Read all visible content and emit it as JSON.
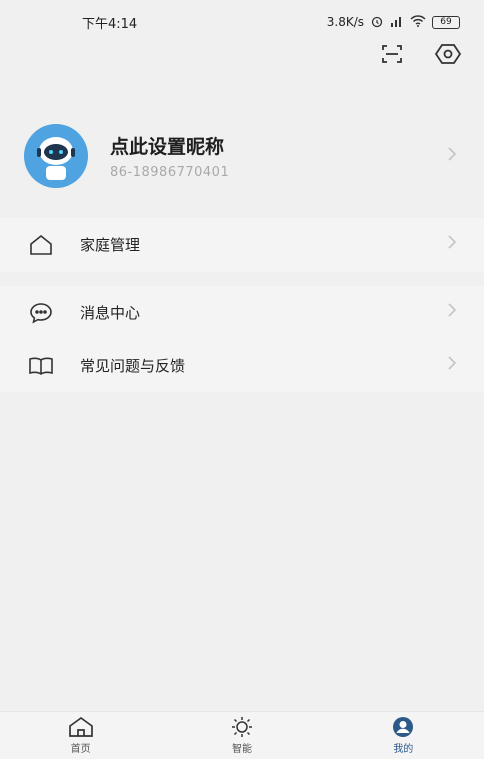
{
  "status_bar": {
    "time": "下午4:14",
    "network_speed": "3.8K/s",
    "battery": "69"
  },
  "top_actions": {
    "scan_icon": "scan-icon",
    "settings_icon": "hexagon-settings-icon"
  },
  "profile": {
    "nickname": "点此设置昵称",
    "phone": "86-18986770401"
  },
  "menu": {
    "home_management": "家庭管理",
    "message_center": "消息中心",
    "faq_feedback": "常见问题与反馈"
  },
  "bottom_nav": {
    "items": [
      {
        "label": "首页",
        "icon": "home-icon"
      },
      {
        "label": "智能",
        "icon": "sun-icon"
      },
      {
        "label": "我的",
        "icon": "user-icon"
      }
    ],
    "active": "我的",
    "active_color": "#2b5a8a"
  }
}
